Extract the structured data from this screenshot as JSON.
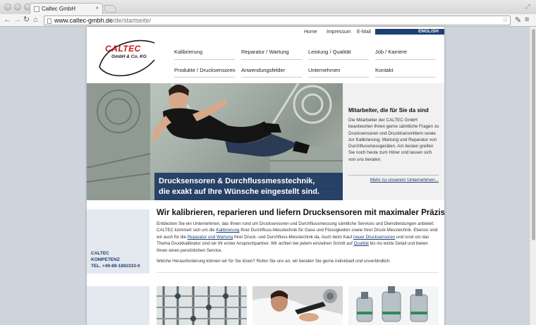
{
  "browser": {
    "tab_title": "Caltec GmbH",
    "url_host": "www.caltec-gmbh.de",
    "url_path": "/de/startseite/"
  },
  "utility_nav": {
    "home": "Home",
    "impressum": "Impressum",
    "email": "E-Mail",
    "language": "ENGLISH"
  },
  "logo": {
    "name": "CALTEC",
    "sub": "GmbH & Co. KG"
  },
  "main_nav": {
    "row1": [
      "Kalibrierung",
      "Reparatur / Wartung",
      "Leistung / Qualität",
      "Job / Karriere"
    ],
    "row2": [
      "Produkte / Drucksensoren",
      "Anwendungsfelder",
      "Unternehmen",
      "Kontakt"
    ]
  },
  "hero": {
    "caption_line1": "Drucksensoren & Durchflussmesstechnik,",
    "caption_line2": "die exakt auf Ihre Wünsche eingestellt sind."
  },
  "side_panel": {
    "title": "Mitarbeiter, die für Sie da sind",
    "text": "Die Mitarbeiter der CALTEC GmbH beantworten Ihnen gerne sämtliche Fragen zu Drucksensoren und Drucktransmittern sowie zur Kalibrierung, Wartung und Reparatur von Durchflussmessgeräten. Am besten greifen Sie noch heute zum Hörer und lassen sich von uns beraten.",
    "link": "Mehr zu unserem Unternehmen..."
  },
  "kompetenz": {
    "line1": "CALTEC",
    "line2": "KOMPETENZ",
    "line3": "TEL. +49-89-1892333-0"
  },
  "content": {
    "headline": "Wir kalibrieren, reparieren und liefern Drucksensoren mit maximaler Präzision.",
    "p1_a": "Entdecken Sie ein Unternehmen, das Ihnen rund um Drucksensoren und Durchflussmessung sämtliche Services und Dienstleistungen anbietet: CALTEC kümmert sich um die ",
    "link_kalibrierung": "Kalibrierung",
    "p1_b": " Ihrer Durchfluss-Messtechnik für Gase und Flüssigkeiten sowie Ihrer Druck-Messtechnik. Ebenso sind wir auch für die ",
    "link_reparatur": "Reparatur und Wartung",
    "p1_c": " Ihrer Druck- und Durchfluss-Messtechnik da.  Auch beim Kauf ",
    "link_drucksensoren": "neuer Drucksensoren",
    "p1_d": " und rund um das Thema Druckkalibrator sind wir Ihr erster Ansprechpartner. Wir achten bei jedem einzelnen Schritt auf ",
    "link_qualitaet": "Qualität",
    "p1_e": " bis ins letzte Detail und bieten Ihnen einen persönlichen Service.",
    "question": "Welche Herausforderung können wir für Sie lösen? Rufen Sie uns an, wir beraten Sie gerne individuell und unverbindlich."
  },
  "colors": {
    "brand_red": "#c8191b",
    "brand_blue": "#1c3f72"
  }
}
